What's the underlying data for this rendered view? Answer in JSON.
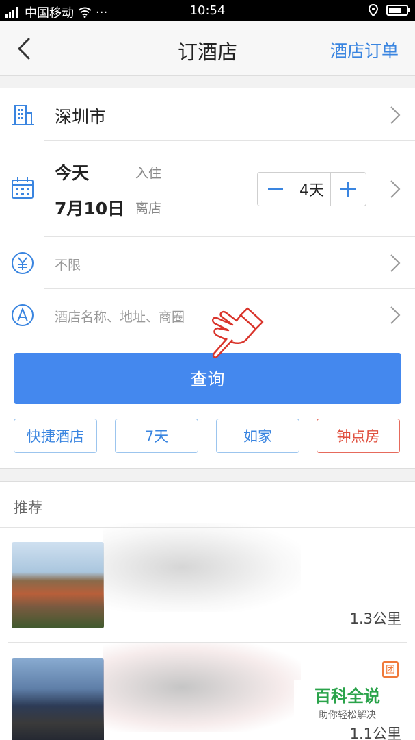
{
  "status_bar": {
    "carrier": "中国移动",
    "time": "10:54",
    "battery_level": 0.75
  },
  "nav": {
    "title": "订酒店",
    "right_link": "酒店订单"
  },
  "search_form": {
    "city": "深圳市",
    "checkin_day": "今天",
    "checkin_label": "入住",
    "checkout_day": "7月10日",
    "checkout_label": "离店",
    "nights": "4天",
    "price_placeholder": "不限",
    "keyword_placeholder": "酒店名称、地址、商圈",
    "search_label": "查询"
  },
  "quick_filters": [
    {
      "label": "快捷酒店"
    },
    {
      "label": "7天"
    },
    {
      "label": "如家"
    },
    {
      "label": "钟点房"
    }
  ],
  "recommend": {
    "header": "推荐",
    "hotels": [
      {
        "distance": "1.3公里"
      },
      {
        "distance": "1.1公里",
        "badge": "团"
      }
    ]
  },
  "watermark": {
    "title": "百科全说",
    "subtitle": "助你轻松解决"
  },
  "colors": {
    "accent": "#4488ee",
    "link": "#3a85e0",
    "hourly_room": "#e0503f"
  }
}
